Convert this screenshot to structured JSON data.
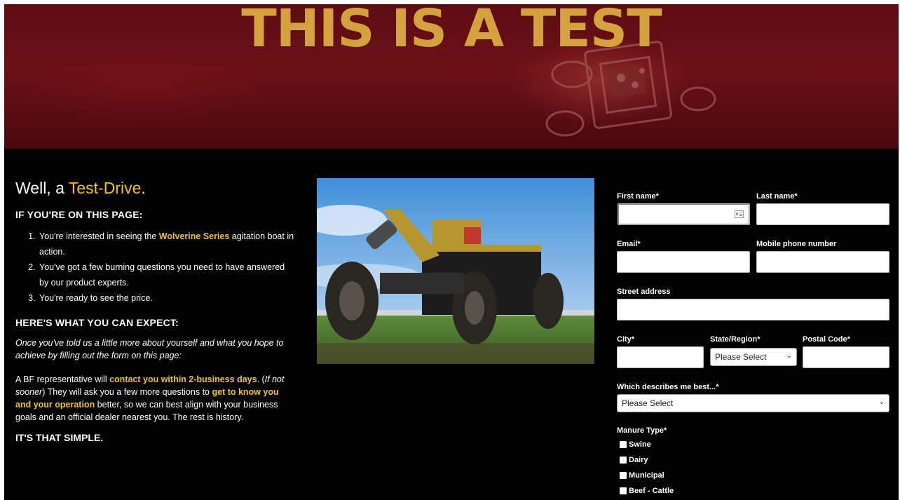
{
  "hero": {
    "title": "THIS IS A TEST"
  },
  "intro": {
    "headline_plain": "Well, a ",
    "headline_highlight": "Test-Drive",
    "headline_end": ".",
    "section1_heading": "IF YOU'RE ON THIS PAGE:",
    "list": [
      {
        "before": "You're interested in seeing the ",
        "highlight": "Wolverine Series",
        "after": " agitation boat in action."
      },
      {
        "text": "You've got a few burning questions you need to have answered by our product experts."
      },
      {
        "text": "You're ready to see the price."
      }
    ],
    "section2_heading": "HERE'S WHAT YOU CAN EXPECT:",
    "italic_paragraph": "Once you've told us a little more about yourself and what you hope to achieve by filling out the form on this page:",
    "p_part1": "A BF representative will ",
    "p_hl1": "contact you within 2-business days",
    "p_part2": ". (",
    "p_italic": "If not sooner",
    "p_part3": ") They will ask you a few more questions to ",
    "p_hl2": "get to know you and your operation",
    "p_part4": " better, so we can best align with your business goals and an official dealer nearest you. The rest is history.",
    "closing": "IT'S THAT SIMPLE."
  },
  "form": {
    "first_name_label": "First name*",
    "last_name_label": "Last name*",
    "email_label": "Email*",
    "mobile_label": "Mobile phone number",
    "street_label": "Street address",
    "city_label": "City*",
    "state_label": "State/Region*",
    "state_value": "Please Select",
    "postal_label": "Postal Code*",
    "describes_label": "Which describes me best...*",
    "describes_value": "Please Select",
    "manure_label": "Manure Type*",
    "manure_options": [
      "Swine",
      "Dairy",
      "Municipal",
      "Beef - Cattle"
    ]
  },
  "colors": {
    "accent": "#f2c418",
    "hero_title": "#d4a23a",
    "background": "#000000"
  }
}
